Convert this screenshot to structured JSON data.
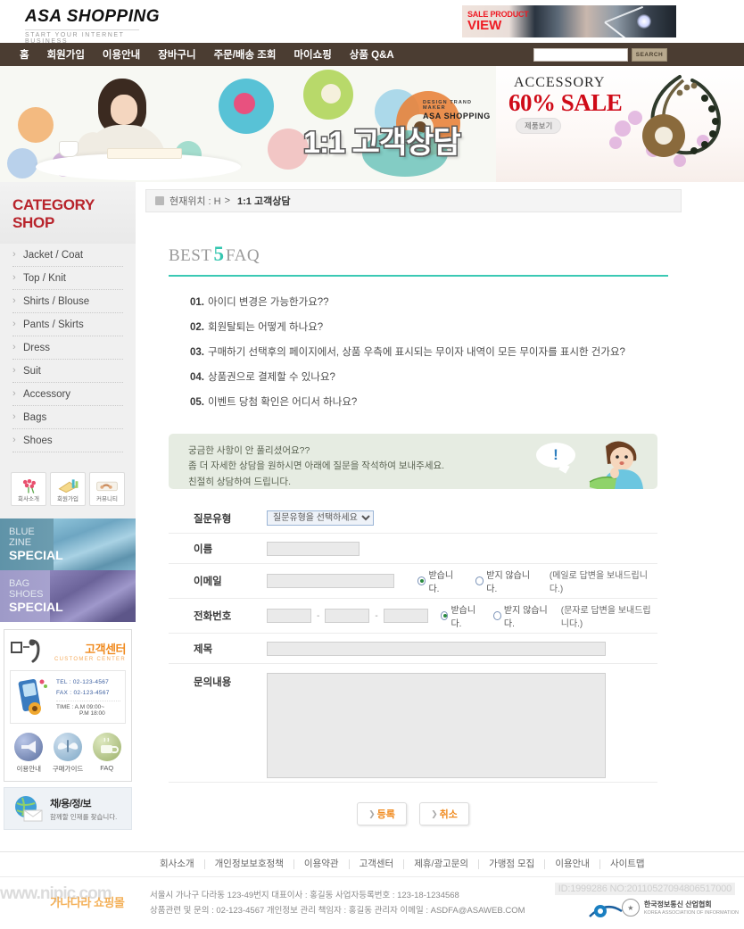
{
  "header": {
    "logo_main": "ASA SHOPPING",
    "logo_sub": "START YOUR INTERNET BUSINESS",
    "top_banner": {
      "line1": "SALE PRODUCT",
      "line2": "VIEW"
    }
  },
  "nav": {
    "items": [
      {
        "label": "홈"
      },
      {
        "label": "회원가입"
      },
      {
        "label": "이용안내"
      },
      {
        "label": "장바구니"
      },
      {
        "label": "주문/배송 조회"
      },
      {
        "label": "마이쇼핑"
      },
      {
        "label": "상품 Q&A"
      }
    ],
    "search_value": "",
    "search_placeholder": "",
    "search_button": "SEARCH"
  },
  "hero": {
    "brand_tagline": "DESIGN TRAND MAKER",
    "brand_name": "ASA SHOPPING",
    "headline": "1:1 고객상담",
    "promo": {
      "title": "ACCESSORY",
      "sale": "60% SALE",
      "button": "제품보기"
    }
  },
  "sidebar": {
    "category_title": "CATEGORY SHOP",
    "categories": [
      {
        "label": "Jacket / Coat"
      },
      {
        "label": "Top / Knit"
      },
      {
        "label": "Shirts / Blouse"
      },
      {
        "label": "Pants / Skirts"
      },
      {
        "label": "Dress"
      },
      {
        "label": "Suit"
      },
      {
        "label": "Accessory"
      },
      {
        "label": "Bags"
      },
      {
        "label": "Shoes"
      }
    ],
    "quick_icons": [
      {
        "label": "회사소개",
        "icon": "flowers-icon"
      },
      {
        "label": "회원가입",
        "icon": "book-pencil-icon"
      },
      {
        "label": "커뮤니티",
        "icon": "handshake-icon"
      }
    ],
    "banners": [
      {
        "line1": "BLUE",
        "line2": "ZINE",
        "line3": "SPECIAL"
      },
      {
        "line1": "BAG",
        "line2": "SHOES",
        "line3": "SPECIAL"
      }
    ],
    "customer_center": {
      "title_kr": "고객센터",
      "title_en": "CUSTOMER CENTER",
      "tel": "TEL : 02-123-4567",
      "fax": "FAX : 02-123-4567",
      "time_line1": "TIME : A.M 09:00~",
      "time_line2": "P.M 18:00",
      "icons": [
        {
          "label": "이용안내",
          "icon": "megaphone-icon"
        },
        {
          "label": "구매가이드",
          "icon": "butterfly-icon"
        },
        {
          "label": "FAQ",
          "icon": "coffee-cup-icon"
        }
      ]
    },
    "recruit": {
      "title": "채/용/정/보",
      "subtitle": "함께할 인재를 찾습니다.",
      "icon": "globe-mail-icon"
    }
  },
  "main": {
    "breadcrumb": {
      "prefix": "현재위치 : H",
      "separator": ">",
      "current": "1:1 고객상담"
    },
    "faq": {
      "title_before": "BEST",
      "title_number": "5",
      "title_after": "FAQ",
      "items": [
        {
          "num": "01.",
          "text": "아이디 변경은 가능한가요??"
        },
        {
          "num": "02.",
          "text": "회원탈퇴는 어떻게 하나요?"
        },
        {
          "num": "03.",
          "text": "구매하기 선택후의 페이지에서, 상품 우측에 표시되는 무이자 내역이 모든 무이자를 표시한 건가요?"
        },
        {
          "num": "04.",
          "text": "상품권으로 결제할 수 있나요?"
        },
        {
          "num": "05.",
          "text": "이벤트 당첨 확인은 어디서 하나요?"
        }
      ]
    },
    "notice": {
      "line1": "궁금한 사항이 안 풀리셨어요??",
      "line2": "좀 더 자세한 상담을 원하시면 아래에 질문을 작석하여 보내주세요.",
      "line3": "친절히 상담하여 드립니다."
    },
    "form": {
      "rows": {
        "type_label": "질문유형",
        "type_selected": "질문유형을 선택하세요",
        "type_options": [
          "질문유형을 선택하세요"
        ],
        "name_label": "이름",
        "name_value": "",
        "email_label": "이메일",
        "email_value": "",
        "email_radio_yes": "받습니다.",
        "email_radio_no": "받지 않습니다.",
        "email_note": "(메일로 답변을 보내드립니다.)",
        "phone_label": "전화번호",
        "phone_p1": "",
        "phone_p2": "",
        "phone_p3": "",
        "phone_radio_yes": "받습니다.",
        "phone_radio_no": "받지 않습니다.",
        "phone_note": "(문자로 답변을 보내드립니다.)",
        "subject_label": "제목",
        "subject_value": "",
        "content_label": "문의내용",
        "content_value": ""
      },
      "submit_button": "등록",
      "cancel_button": "취소"
    }
  },
  "footer": {
    "links": [
      {
        "label": "회사소개"
      },
      {
        "label": "개인정보보호정책"
      },
      {
        "label": "이용약관"
      },
      {
        "label": "고객센터"
      },
      {
        "label": "제휴/광고문의"
      },
      {
        "label": "가맹점 모집"
      },
      {
        "label": "이용안내"
      },
      {
        "label": "사이트맵"
      }
    ],
    "address_line1": "서울시 가나구 다라동 123-49번지  대표이사 : 홍길동  사업자등록번호 : 123-18-1234568",
    "address_line2": "상품관련 및 문의 : 02-123-4567  개인정보 관리 책임자 : 홍길동  관리자 이메일 : ASDFA@ASAWEB.COM",
    "watermark": "www.nipic.com",
    "watermark_kr": "가나다라 쇼핑몰",
    "cert_id": "ID:1999286 NO:20110527094806517000",
    "cert_name": "한국정보통신 산업협회",
    "cert_sub": "KOREA ASSOCIATION OF INFORMATION"
  },
  "colors": {
    "nav_bg": "#4b3d32",
    "accent_red": "#b8232b",
    "accent_teal": "#3bc9b4",
    "accent_orange": "#f08a1e",
    "sale_red": "#cf0a17"
  }
}
